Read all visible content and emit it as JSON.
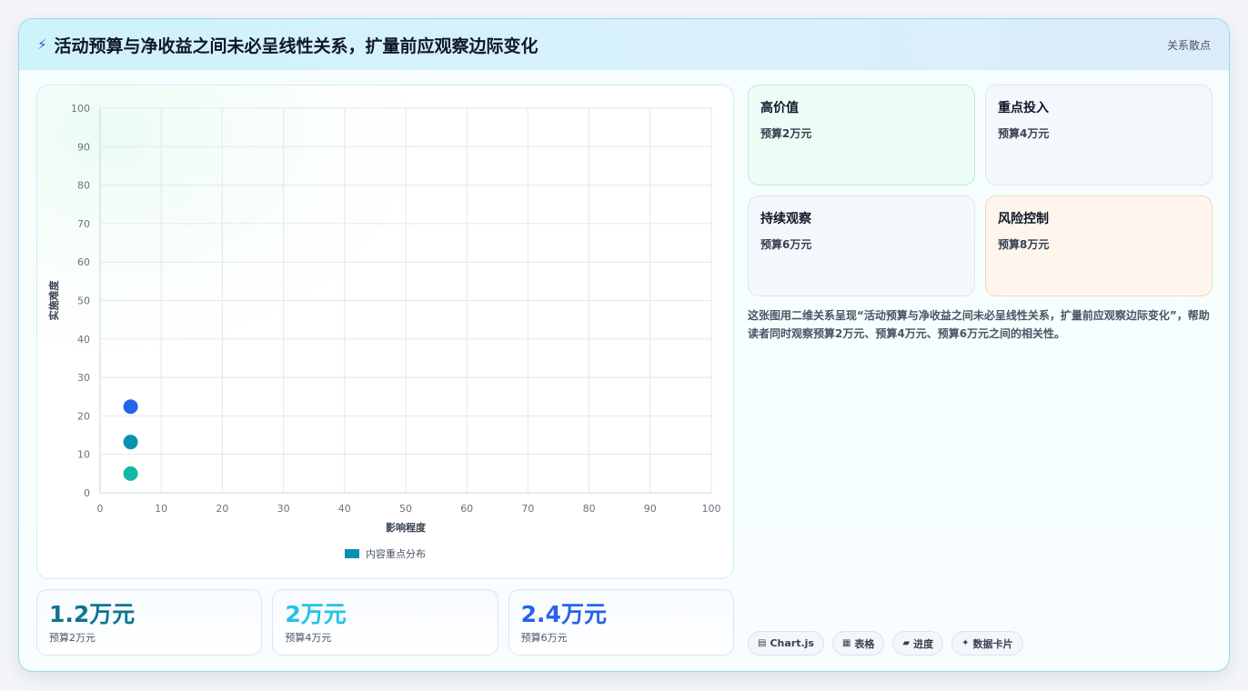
{
  "header": {
    "icon": "lightning-icon",
    "title": "活动预算与净收益之间未必呈线性关系，扩量前应观察边际变化",
    "tag": "关系散点"
  },
  "chart_data": {
    "type": "scatter",
    "xlabel": "影响程度",
    "ylabel": "实施难度",
    "xlim": [
      0,
      100
    ],
    "ylim": [
      0,
      100
    ],
    "xticks": [
      0,
      10,
      20,
      30,
      40,
      50,
      60,
      70,
      80,
      90,
      100
    ],
    "yticks": [
      0,
      10,
      20,
      30,
      40,
      50,
      60,
      70,
      80,
      90,
      100
    ],
    "grid": true,
    "legend_position": "bottom",
    "series": [
      {
        "name": "内容重点分布",
        "color": "#0891b2",
        "points": [
          {
            "x": 5,
            "y": 22.4,
            "color": "#2563eb"
          },
          {
            "x": 5,
            "y": 13.2,
            "color": "#0891b2"
          },
          {
            "x": 5,
            "y": 5,
            "color": "#14b8a6"
          }
        ]
      }
    ]
  },
  "kpis": [
    {
      "value": "1.2万元",
      "label": "预算2万元",
      "color": "#0e7490"
    },
    {
      "value": "2万元",
      "label": "预算4万元",
      "color": "#22c3e6"
    },
    {
      "value": "2.4万元",
      "label": "预算6万元",
      "color": "#2563eb"
    }
  ],
  "quadrants": [
    {
      "title": "高价值",
      "sub": "预算2万元"
    },
    {
      "title": "重点投入",
      "sub": "预算4万元"
    },
    {
      "title": "持续观察",
      "sub": "预算6万元"
    },
    {
      "title": "风险控制",
      "sub": "预算8万元"
    }
  ],
  "description": "这张图用二维关系呈现“活动预算与净收益之间未必呈线性关系，扩量前应观察边际变化”，帮助读者同时观察预算2万元、预算4万元、预算6万元之间的相关性。",
  "chips": [
    {
      "icon": "▤",
      "label": "Chart.js"
    },
    {
      "icon": "▦",
      "label": "表格"
    },
    {
      "icon": "▰",
      "label": "进度"
    },
    {
      "icon": "✦",
      "label": "数据卡片"
    }
  ]
}
